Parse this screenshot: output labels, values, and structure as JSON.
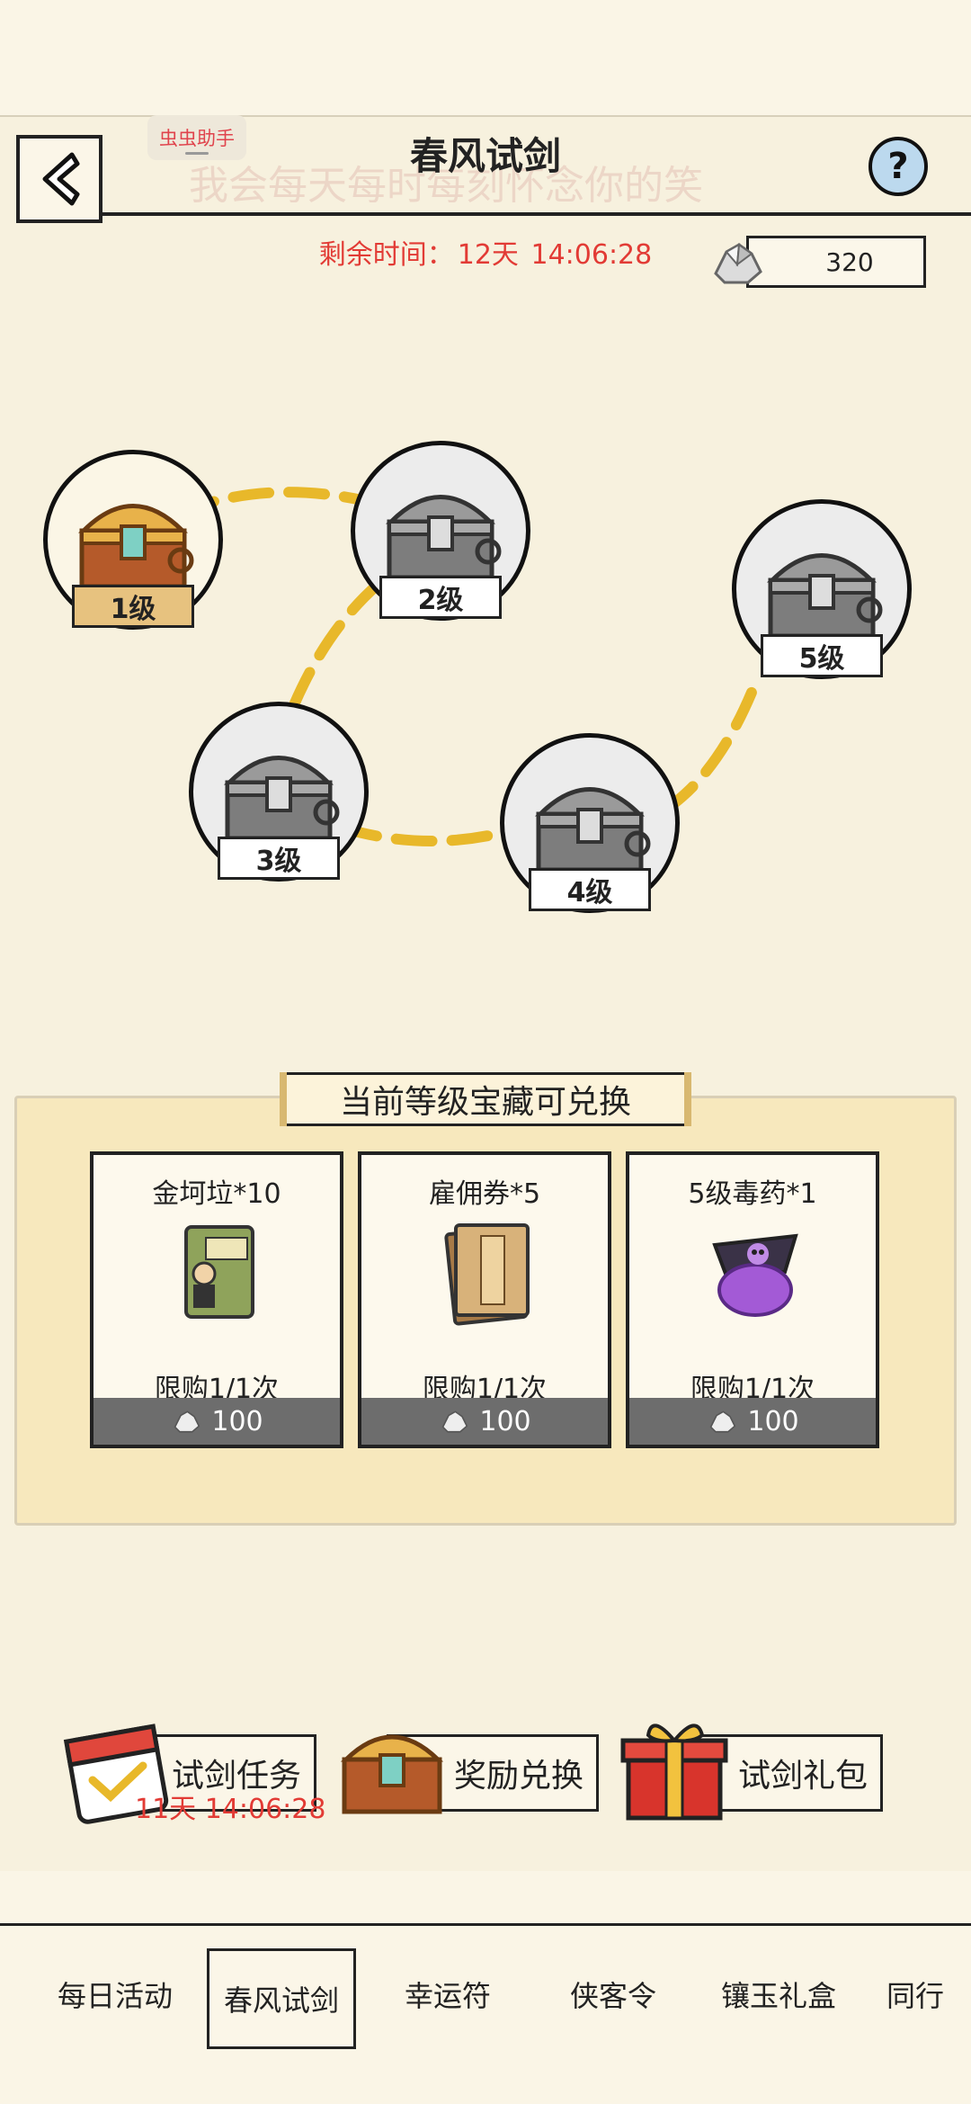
{
  "header": {
    "title": "春风试剑",
    "helper_badge": "虫虫助手",
    "watermark": "我会每天每时每刻怀念你的笑",
    "remain_label": "剩余时间：",
    "remain_days": "12天",
    "remain_time": "14:06:28",
    "currency_amount": "320"
  },
  "levels": [
    {
      "label": "1级",
      "active": true
    },
    {
      "label": "2级",
      "active": false
    },
    {
      "label": "3级",
      "active": false
    },
    {
      "label": "4级",
      "active": false
    },
    {
      "label": "5级",
      "active": false
    }
  ],
  "exchange": {
    "title": "当前等级宝藏可兑换",
    "items": [
      {
        "name": "金坷垃*10",
        "limit": "限购1/1次",
        "price": "100",
        "icon": "fertilizer-bag-icon"
      },
      {
        "name": "雇佣券*5",
        "limit": "限购1/1次",
        "price": "100",
        "icon": "scroll-ticket-icon"
      },
      {
        "name": "5级毒药*1",
        "limit": "限购1/1次",
        "price": "100",
        "icon": "poison-bag-icon"
      }
    ]
  },
  "actions": {
    "task_label": "试剑任务",
    "task_timer": "11天 14:06:28",
    "exchange_label": "奖励兑换",
    "gift_label": "试剑礼包"
  },
  "nav": {
    "items": [
      "每日活动",
      "春风试剑",
      "幸运符",
      "侠客令",
      "镶玉礼盒",
      "同行"
    ],
    "active_index": 1
  },
  "colors": {
    "background": "#f7f1de",
    "accent_red": "#e23b35",
    "active_level": "#e7c27f",
    "path_yellow": "#e8b82a",
    "price_bar": "#6d6d6d"
  }
}
